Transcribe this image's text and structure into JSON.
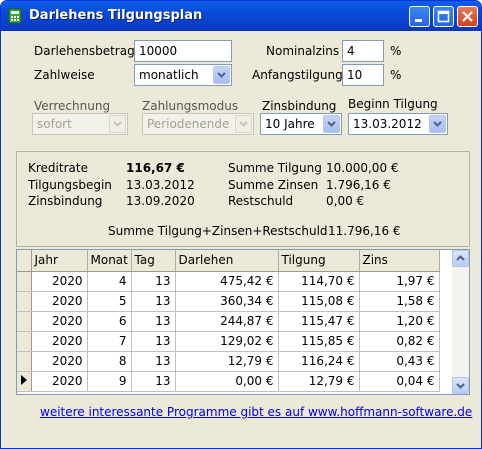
{
  "window": {
    "title": "Darlehens Tilgungsplan"
  },
  "form": {
    "darlehensbetrag_label": "Darlehensbetrag",
    "darlehensbetrag_value": "10000",
    "zahlweise_label": "Zahlweise",
    "zahlweise_value": "monatlich",
    "nominalzins_label": "Nominalzins",
    "nominalzins_value": "4",
    "nominalzins_unit": "%",
    "anfangstilgung_label": "Anfangstilgung",
    "anfangstilgung_value": "10",
    "anfangstilgung_unit": "%",
    "verrechnung_label": "Verrechnung",
    "verrechnung_value": "sofort",
    "zahlungsmodus_label": "Zahlungsmodus",
    "zahlungsmodus_value": "Periodenende",
    "zinsbindung_label": "Zinsbindung",
    "zinsbindung_value": "10 Jahre",
    "beginn_label": "Beginn Tilgung",
    "beginn_value": "13.03.2012"
  },
  "summary": {
    "kreditrate_label": "Kreditrate",
    "kreditrate_value": "116,67 €",
    "tilgungsbegin_label": "Tilgungsbegin",
    "tilgungsbegin_value": "13.03.2012",
    "zinsbindung_label": "Zinsbindung",
    "zinsbindung_value": "13.09.2020",
    "summe_tilgung_label": "Summe Tilgung",
    "summe_tilgung_value": "10.000,00 €",
    "summe_zinsen_label": "Summe Zinsen",
    "summe_zinsen_value": "1.796,16 €",
    "restschuld_label": "Restschuld",
    "restschuld_value": "0,00 €",
    "gesamt_label": "Summe Tilgung+Zinsen+Restschuld",
    "gesamt_value": "11.796,16 €"
  },
  "table": {
    "headers": [
      "Jahr",
      "Monat",
      "Tag",
      "Darlehen",
      "Tilgung",
      "Zins"
    ],
    "rows": [
      [
        "2020",
        "4",
        "13",
        "475,42 €",
        "114,70 €",
        "1,97 €"
      ],
      [
        "2020",
        "5",
        "13",
        "360,34 €",
        "115,08 €",
        "1,58 €"
      ],
      [
        "2020",
        "6",
        "13",
        "244,87 €",
        "115,47 €",
        "1,20 €"
      ],
      [
        "2020",
        "7",
        "13",
        "129,02 €",
        "115,85 €",
        "0,82 €"
      ],
      [
        "2020",
        "8",
        "13",
        "12,79 €",
        "116,24 €",
        "0,43 €"
      ],
      [
        "2020",
        "9",
        "13",
        "0,00 €",
        "12,79 €",
        "0,04 €"
      ]
    ],
    "current_row": 5
  },
  "footer": {
    "link_text": "weitere interessante Programme gibt es auf www.hoffmann-software.de"
  },
  "icons": [
    "calculator-icon",
    "minimize-icon",
    "maximize-icon",
    "close-icon",
    "chevron-down-icon",
    "scroll-up-icon",
    "scroll-down-icon",
    "row-pointer-icon"
  ]
}
